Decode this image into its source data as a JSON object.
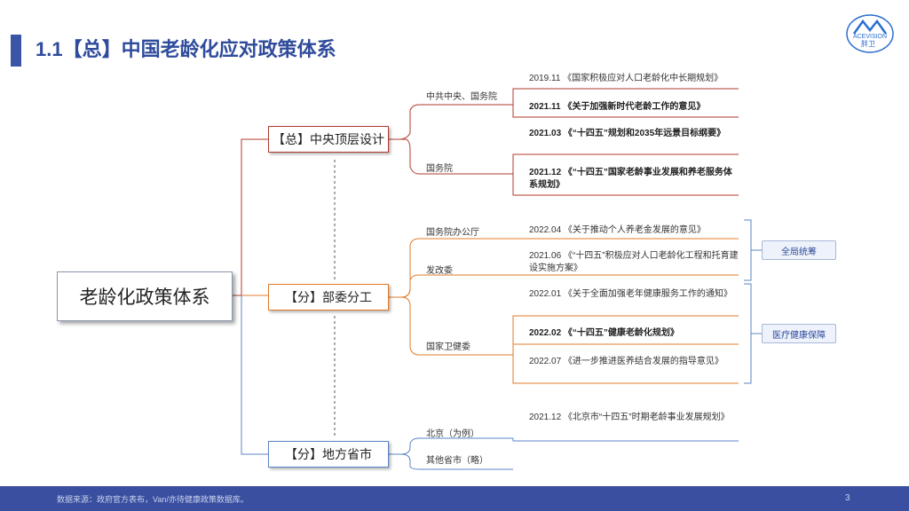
{
  "header": {
    "title": "1.1【总】中国老龄化应对政策体系",
    "logo_text": "ACEVISION",
    "logo_name": "胖卫"
  },
  "root": {
    "label": "老龄化政策体系"
  },
  "nodes": [
    {
      "label": "【总】中央顶层设计"
    },
    {
      "label": "【分】部委分工"
    },
    {
      "label": "【分】地方省市"
    }
  ],
  "branches": {
    "central": [
      "中共中央、国务院",
      "国务院"
    ],
    "ministry": [
      "国务院办公厅",
      "发改委",
      "国家卫健委"
    ],
    "local": [
      "北京（为例）",
      "其他省市（略）"
    ]
  },
  "leaves": {
    "central": [
      "2019.11 《国家积极应对人口老龄化中长期规划》",
      "2021.11 《关于加强新时代老龄工作的意见》",
      "2021.03 《“十四五”规划和2035年远景目标纲要》",
      "2021.12 《“十四五”国家老龄事业发展和养老服务体系规划》"
    ],
    "ministry": [
      "2022.04 《关于推动个人养老金发展的意见》",
      "2021.06 《“十四五”积极应对人口老龄化工程和托育建设实施方案》",
      "2022.01 《关于全面加强老年健康服务工作的通知》",
      "2022.02 《“十四五”健康老龄化规划》",
      "2022.07 《进一步推进医养结合发展的指导意见》"
    ],
    "local": [
      "2021.12 《北京市“十四五”时期老龄事业发展规划》"
    ]
  },
  "tags": [
    "全局统筹",
    "医疗健康保障"
  ],
  "footer": {
    "source": "数据来源：政府官方表布，Van/亦待健康政策数据库。",
    "page": "3"
  },
  "colors": {
    "title": "#2f4b9b",
    "central": "#b03a2e",
    "ministry": "#e07b2a",
    "local": "#5b84c4",
    "footer_bg": "#3a4fa0"
  }
}
